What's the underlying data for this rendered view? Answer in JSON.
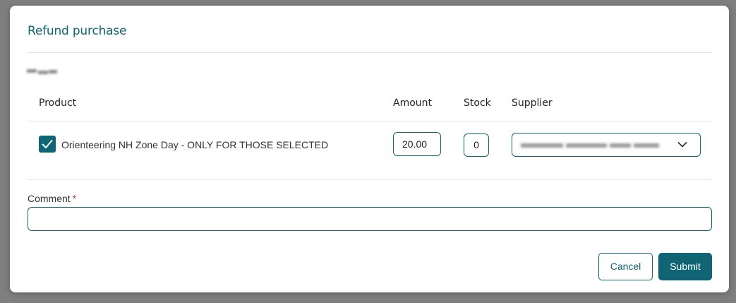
{
  "dialog": {
    "title": "Refund purchase"
  },
  "table": {
    "headers": {
      "product": "Product",
      "amount": "Amount",
      "stock": "Stock",
      "supplier": "Supplier"
    },
    "rows": [
      {
        "checked": true,
        "product": "Orienteering NH Zone Day - ONLY FOR THOSE SELECTED",
        "amount": "20.00",
        "stock": "0"
      }
    ]
  },
  "comment": {
    "label": "Comment",
    "required_marker": "*",
    "value": ""
  },
  "buttons": {
    "cancel": "Cancel",
    "submit": "Submit"
  },
  "icons": {
    "checkbox": "check-icon",
    "supplier_dropdown": "chevron-down-icon"
  },
  "colors": {
    "accent": "#0f6574",
    "required": "#c0392b"
  }
}
